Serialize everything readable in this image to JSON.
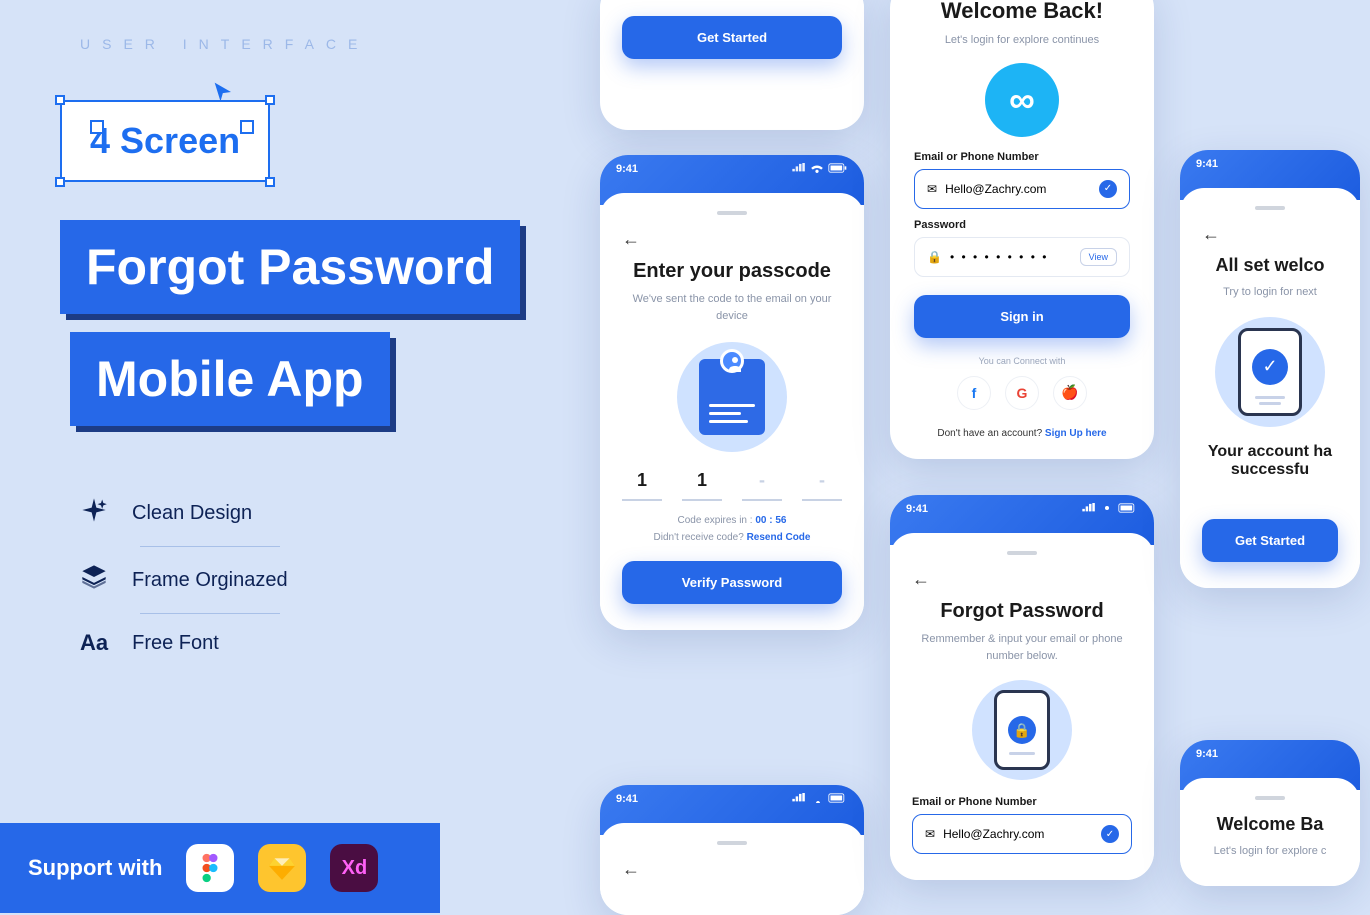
{
  "left": {
    "ui_label": "USER INTERFACE",
    "four_screen": "4 Screen",
    "title1": "Forgot Password",
    "title2": "Mobile App",
    "feat1": "Clean Design",
    "feat2": "Frame Orginazed",
    "feat3": "Free Font",
    "support": "Support with",
    "figma": "Fg",
    "sketch": "◆",
    "xd": "Xd"
  },
  "partial_top": {
    "btn": "Get Started"
  },
  "passcode": {
    "time": "9:41",
    "title": "Enter your passcode",
    "sub": "We've sent the code to the email on your device",
    "pin": [
      "1",
      "1",
      "-",
      "-"
    ],
    "expire_prefix": "Code expires in :",
    "expire_time": "00 : 56",
    "resend_q": "Didn't receive code?",
    "resend_a": "Resend Code",
    "btn": "Verify Password"
  },
  "login": {
    "title": "Welcome Back!",
    "sub": "Let's login for explore continues",
    "email_label": "Email or Phone Number",
    "email_value": "Hello@Zachry.com",
    "pw_label": "Password",
    "pw_value": "• • • • • • • • •",
    "view": "View",
    "signin": "Sign in",
    "connect": "You can Connect with",
    "fb": "f",
    "google": "G",
    "apple": "🍎",
    "noacct": "Don't have an account?",
    "signup": "Sign Up here"
  },
  "forgot": {
    "time": "9:41",
    "title": "Forgot Password",
    "sub": "Remmember & input your email or phone number below.",
    "email_label": "Email or Phone Number",
    "email_value": "Hello@Zachry.com"
  },
  "success": {
    "time": "9:41",
    "title": "All set welco",
    "sub": "Try to login for next",
    "big": "Your account ha",
    "big2": "successfu",
    "btn": "Get Started"
  },
  "welcome_partial": {
    "time": "9:41",
    "title": "Welcome Ba",
    "sub": "Let's login for explore c"
  },
  "passcode2_time": "9:41"
}
